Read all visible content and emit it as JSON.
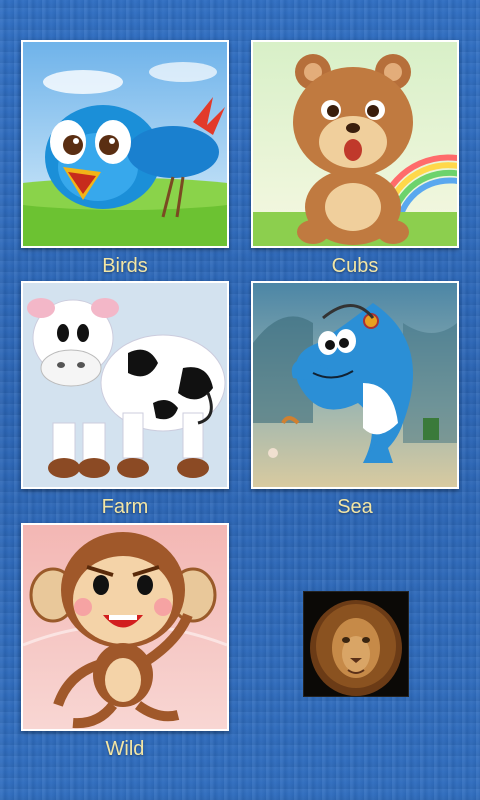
{
  "categories": [
    {
      "id": "birds",
      "label": "Birds",
      "icon": "bird-cartoon-icon"
    },
    {
      "id": "cubs",
      "label": "Cubs",
      "icon": "bear-cub-cartoon-icon"
    },
    {
      "id": "farm",
      "label": "Farm",
      "icon": "cow-cartoon-icon"
    },
    {
      "id": "sea",
      "label": "Sea",
      "icon": "dolphin-cartoon-icon"
    },
    {
      "id": "wild",
      "label": "Wild",
      "icon": "monkey-cartoon-icon"
    }
  ],
  "extra_button": {
    "icon": "lion-photo-icon"
  },
  "colors": {
    "background": "#2d68bb",
    "label": "#f3e6a5",
    "frame": "#ffffff"
  }
}
